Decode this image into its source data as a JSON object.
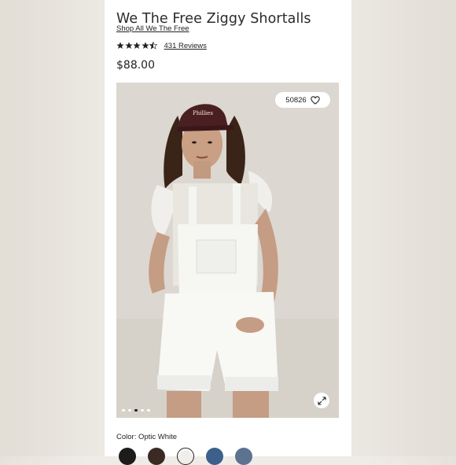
{
  "product": {
    "title": "We The Free Ziggy Shortalls",
    "shop_link": "Shop All We The Free",
    "rating": 4.5,
    "reviews_label": "431 Reviews",
    "price": "$88.00"
  },
  "gallery": {
    "favorite_count": "50826",
    "slide_count": 5,
    "active_slide": 3
  },
  "color": {
    "label": "Color: Optic White",
    "swatches": [
      {
        "name": "black",
        "hex": "#1e1b1b"
      },
      {
        "name": "brown",
        "hex": "#3b2a24"
      },
      {
        "name": "optic-white",
        "hex": "#efeeea",
        "selected": true
      },
      {
        "name": "blue",
        "hex": "#3c5f8c"
      },
      {
        "name": "light-blue",
        "hex": "#5d7190"
      }
    ]
  },
  "colors": {
    "page_bg": "#efece7",
    "panel_bg": "#ffffff",
    "text": "#222222"
  },
  "icons": {
    "favorite": "heart-icon",
    "expand": "expand-arrows-icon",
    "rating": "star-icon"
  }
}
